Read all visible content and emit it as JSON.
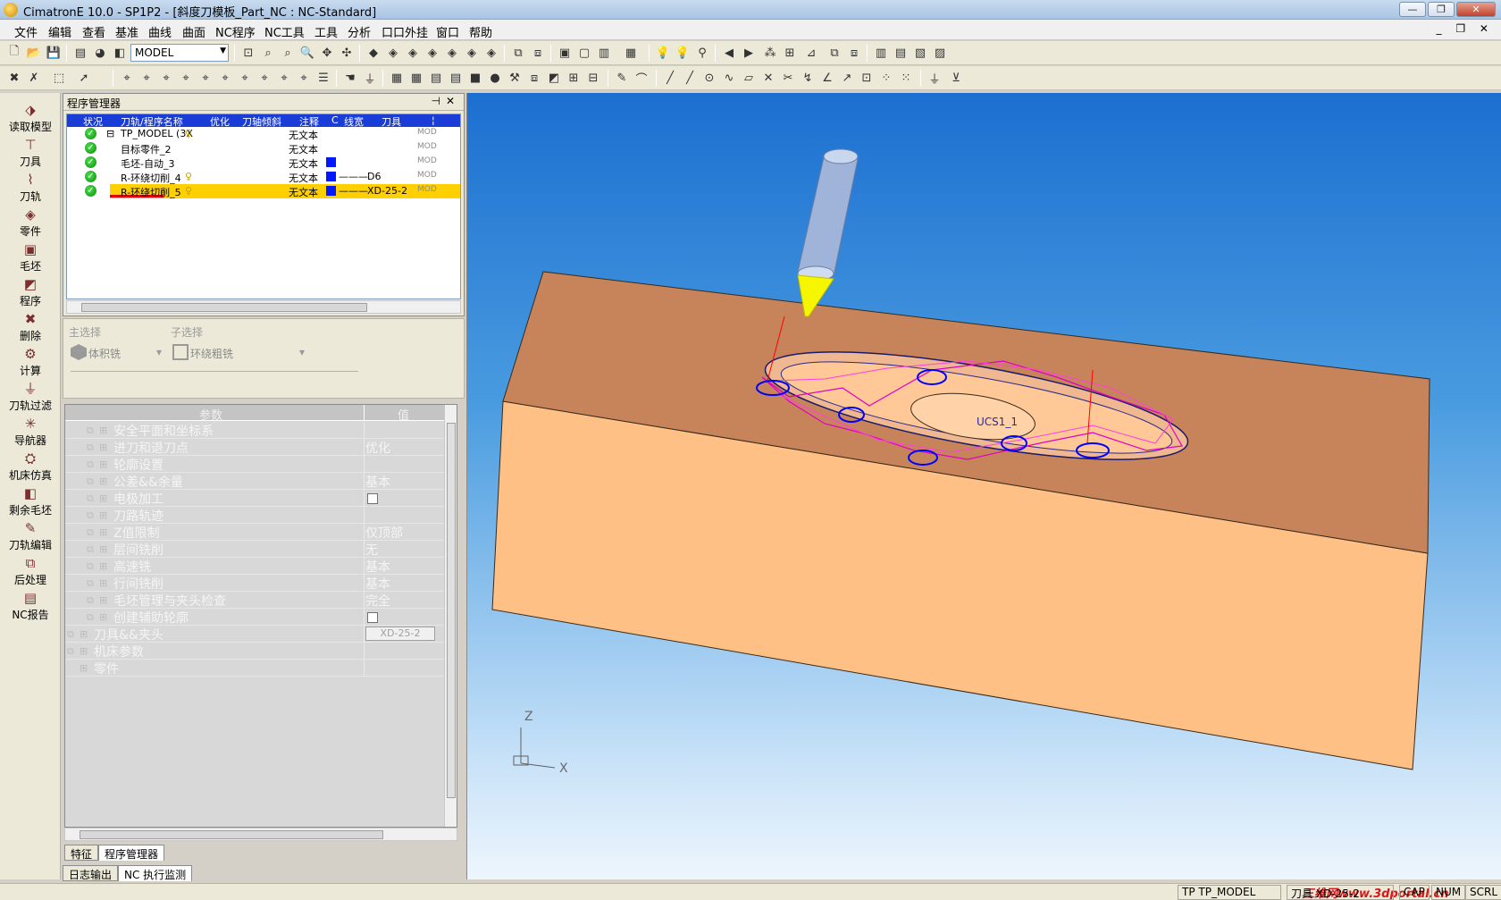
{
  "window": {
    "title": "CimatronE 10.0 - SP1P2 - [斜度刀模板_Part_NC : NC-Standard]",
    "min": "—",
    "restore": "❐",
    "close": "✕"
  },
  "menu": {
    "items": [
      "文件",
      "编辑",
      "查看",
      "基准",
      "曲线",
      "曲面",
      "NC程序",
      "NC工具",
      "工具",
      "分析",
      "口口外挂",
      "窗口",
      "帮助"
    ],
    "mdi": "_ ❐ ✕"
  },
  "toolbar": {
    "model_select": "MODEL"
  },
  "sidebar": {
    "items": [
      "读取模型",
      "刀具",
      "刀轨",
      "零件",
      "毛坯",
      "程序",
      "删除",
      "计算",
      "刀轨过滤",
      "导航器",
      "机床仿真",
      "剩余毛坯",
      "刀轨编辑",
      "后处理",
      "NC报告"
    ]
  },
  "program_manager": {
    "title": "程序管理器",
    "pin": "⊣",
    "close": "✕",
    "columns": [
      "状况",
      "刀轨/程序名称",
      "优化",
      "刀轴倾斜",
      "注释",
      "C",
      "线宽",
      "刀具",
      "¦"
    ],
    "rows": [
      {
        "name": "TP_MODEL (3X",
        "comment": "无文本",
        "tool": "",
        "mod": "MOD"
      },
      {
        "name": "目标零件_2",
        "comment": "无文本",
        "tool": "",
        "mod": "MOD"
      },
      {
        "name": "毛坯-自动_3",
        "comment": "无文本",
        "tool": "",
        "mod": "MOD"
      },
      {
        "name": "R-环绕切削_4",
        "comment": "无文本",
        "tool": "D6",
        "mod": "MOD"
      },
      {
        "name": "R-环绕切削_5",
        "comment": "无文本",
        "tool": "XD-25-2",
        "mod": "MOD"
      }
    ]
  },
  "selection": {
    "main_label": "主选择",
    "main_value": "体积铣",
    "sub_label": "子选择",
    "sub_value": "环绕粗铣"
  },
  "params": {
    "col_param": "参数",
    "col_value": "值",
    "rows": [
      {
        "name": "安全平面和坐标系",
        "value": "",
        "type": "text"
      },
      {
        "name": "进刀和退刀点",
        "value": "优化",
        "type": "text"
      },
      {
        "name": "轮廓设置",
        "value": "",
        "type": "text"
      },
      {
        "name": "公差&&余量",
        "value": "基本",
        "type": "text"
      },
      {
        "name": "电极加工",
        "value": "",
        "type": "check"
      },
      {
        "name": "刀路轨迹",
        "value": "",
        "type": "text"
      },
      {
        "name": "Z值限制",
        "value": "仅顶部",
        "type": "text"
      },
      {
        "name": "层间铣削",
        "value": "无",
        "type": "text"
      },
      {
        "name": "高速铣",
        "value": "基本",
        "type": "text"
      },
      {
        "name": "行间铣削",
        "value": "基本",
        "type": "text"
      },
      {
        "name": "毛坯管理与夹头检查",
        "value": "完全",
        "type": "text"
      },
      {
        "name": "创建辅助轮廓",
        "value": "",
        "type": "check"
      }
    ],
    "group_rows": [
      {
        "name": "刀具&&夹头",
        "value": "XD-25-2"
      },
      {
        "name": "机床参数",
        "value": ""
      },
      {
        "name": "零件",
        "value": ""
      }
    ]
  },
  "tabs": {
    "feature": "特征",
    "program_manager": "程序管理器",
    "log_output": "日志输出",
    "nc_monitor": "NC 执行监测"
  },
  "viewport": {
    "axis_z": "Z",
    "axis_x": "X",
    "origin_label": "UCS1_1"
  },
  "status": {
    "tp_label": "TP",
    "tp_value": "TP_MODEL",
    "tool_label": "刀具",
    "tool_value": "XD-25-2",
    "cap": "CAP",
    "num": "NUM",
    "scrl": "SCRL",
    "watermark": "三维网www.3dportal.cn"
  },
  "colors": {
    "selected_row": "#ffd000",
    "tree_header": "#1a3dd8",
    "stock_top": "#c7845a",
    "stock_front": "#ffc086",
    "toolpath": "#e000c8"
  }
}
